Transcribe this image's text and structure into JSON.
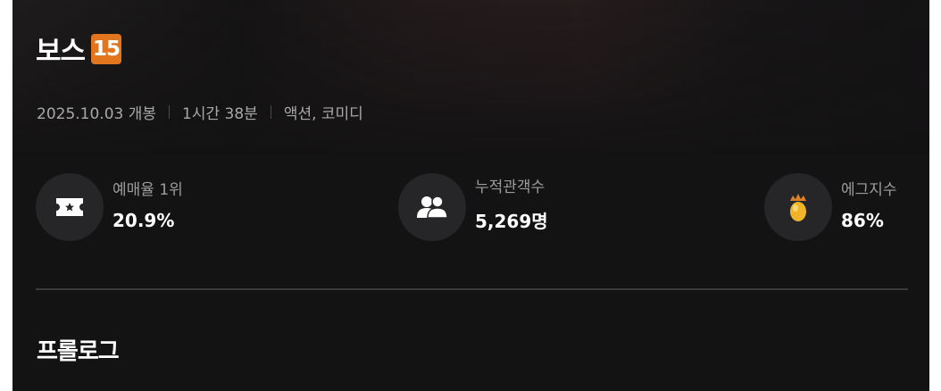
{
  "movie": {
    "title": "보스",
    "age_rating": "15",
    "release": "2025.10.03 개봉",
    "runtime": "1시간 38분",
    "genres": "액션, 코미디"
  },
  "stats": [
    {
      "label": "예매율 1위",
      "value": "20.9%",
      "icon": "ticket-icon"
    },
    {
      "label": "누적관객수",
      "value": "5,269명",
      "icon": "audience-icon"
    },
    {
      "label": "에그지수",
      "value": "86%",
      "icon": "golden-egg-icon"
    }
  ],
  "sections": {
    "prologue_title": "프롤로그"
  },
  "colors": {
    "background": "#141314",
    "age_badge": "#e2761e",
    "icon_circle": "#262628",
    "egg": "#f0b429"
  }
}
